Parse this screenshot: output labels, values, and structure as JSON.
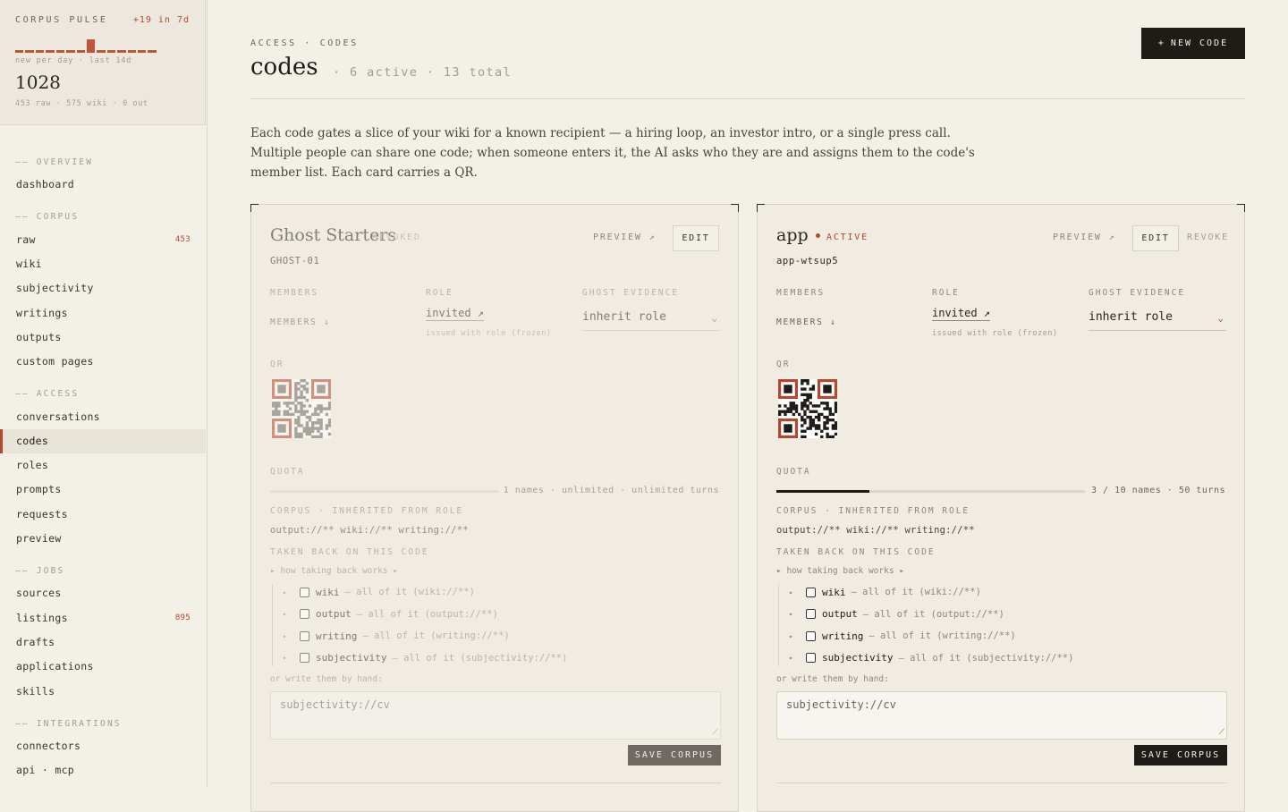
{
  "pulse": {
    "title": "CORPUS PULSE",
    "delta": "+19 in 7d",
    "caption": "new per day · last 14d",
    "spark": [
      1,
      1,
      1,
      1,
      1,
      1,
      1,
      5,
      1,
      1,
      1,
      1,
      1,
      1
    ],
    "total": "1028",
    "breakdown": "453 raw · 575 wiki · 0 out"
  },
  "nav": {
    "overview": "—— OVERVIEW",
    "dashboard": "dashboard",
    "corpus": "—— CORPUS",
    "raw": "raw",
    "raw_count": "453",
    "wiki": "wiki",
    "subjectivity": "subjectivity",
    "writings": "writings",
    "outputs": "outputs",
    "custom_pages": "custom pages",
    "access": "—— ACCESS",
    "conversations": "conversations",
    "codes": "codes",
    "roles": "roles",
    "prompts": "prompts",
    "requests": "requests",
    "preview": "preview",
    "jobs": "—— JOBS",
    "sources": "sources",
    "listings": "listings",
    "listings_count": "895",
    "drafts": "drafts",
    "applications": "applications",
    "skills": "skills",
    "integrations": "—— INTEGRATIONS",
    "connectors": "connectors",
    "api_mcp": "api · mcp"
  },
  "header": {
    "breadcrumb": "ACCESS · CODES",
    "title": "codes",
    "subtitle": "· 6 active · 13 total",
    "new_code": "NEW CODE",
    "new_code_icon": "+"
  },
  "intro": "Each code gates a slice of your wiki for a known recipient — a hiring loop, an investor intro, or a single press call. Multiple people can share one code; when someone enters it, the AI asks who they are and assigns them to the code's member list. Each card carries a QR.",
  "labels": {
    "members": "MEMBERS",
    "members_sort": "MEMBERS ↓",
    "role": "ROLE",
    "ghost_evidence": "GHOST EVIDENCE",
    "qr": "QR",
    "quota": "QUOTA",
    "corpus_inherited": "CORPUS · INHERITED FROM ROLE",
    "taken_back": "TAKEN BACK ON THIS CODE",
    "how_taking_back": "▸ how taking back works ▸",
    "by_hand": "or write them by hand:",
    "preview": "PREVIEW ↗",
    "edit": "EDIT",
    "revoke": "REVOKE",
    "save_corpus": "SAVE CORPUS",
    "role_note": "issued with role (frozen)"
  },
  "cards": [
    {
      "name": "Ghost Starters",
      "status": "REVOKED",
      "code": "GHOST-01",
      "role": "invited ↗",
      "ghost_evidence": "inherit role",
      "quota_fraction": 0,
      "quota_text": "1 names · unlimited · unlimited turns",
      "corpus_paths": "output://**  wiki://**  writing://**",
      "take_back": [
        {
          "name": "wiki",
          "desc": "— all of it (wiki://**)"
        },
        {
          "name": "output",
          "desc": "— all of it (output://**)"
        },
        {
          "name": "writing",
          "desc": "— all of it (writing://**)"
        },
        {
          "name": "subjectivity",
          "desc": "— all of it (subjectivity://**)"
        }
      ],
      "placeholder": "subjectivity://cv"
    },
    {
      "name": "app",
      "status": "ACTIVE",
      "code": "app-wtsup5",
      "role": "invited ↗",
      "ghost_evidence": "inherit role",
      "quota_fraction": 0.3,
      "quota_text": "3 / 10 names · 50 turns",
      "corpus_paths": "output://**  wiki://**  writing://**",
      "take_back": [
        {
          "name": "wiki",
          "desc": "— all of it (wiki://**)"
        },
        {
          "name": "output",
          "desc": "— all of it (output://**)"
        },
        {
          "name": "writing",
          "desc": "— all of it (writing://**)"
        },
        {
          "name": "subjectivity",
          "desc": "— all of it (subjectivity://**)"
        }
      ],
      "placeholder": "subjectivity://cv"
    }
  ],
  "colors": {
    "accent": "#b8452c",
    "ink": "#1f1b17",
    "paper": "#f3f0e7",
    "qr_dark_active": "#1f1b17",
    "qr_dark_revoked": "#6f6b64",
    "qr_finder_accent": "#b8452c"
  },
  "icons": {
    "chevron": "chevron-down-icon",
    "arrow_out": "external-arrow-icon",
    "sort": "sort-down-icon",
    "resize": "resize-grip-icon",
    "expand": "triangle-right-icon"
  }
}
